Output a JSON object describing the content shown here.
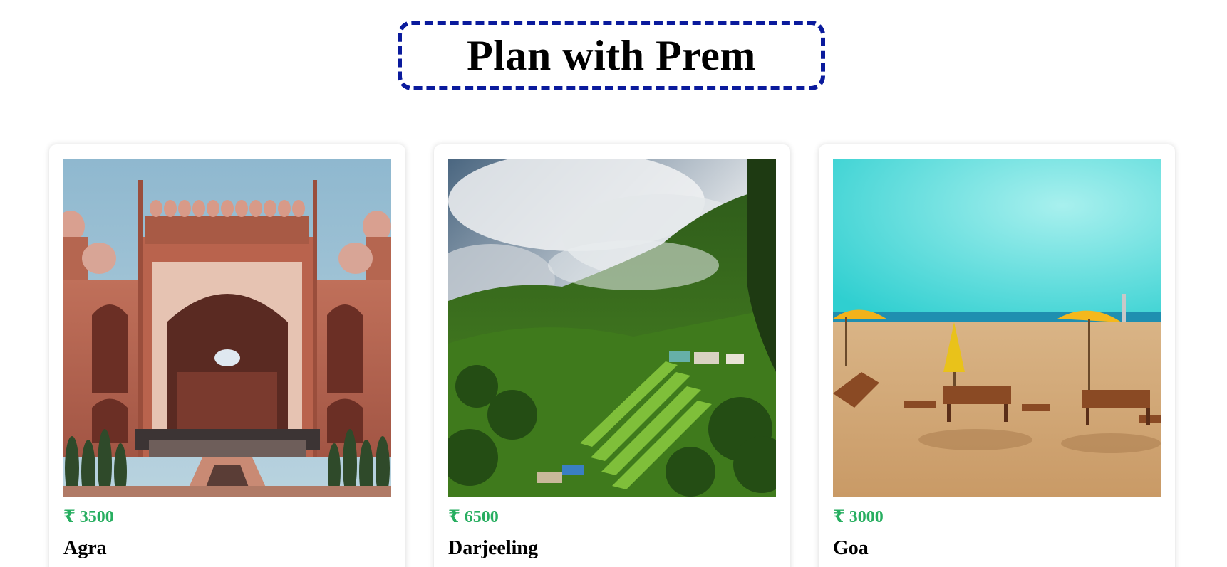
{
  "header": {
    "title": "Plan with Prem"
  },
  "destinations": [
    {
      "price": "₹ 3500",
      "name": "Agra",
      "image": "taj-mahal-gate-photo"
    },
    {
      "price": "₹ 6500",
      "name": "Darjeeling",
      "image": "misty-hills-photo"
    },
    {
      "price": "₹ 3000",
      "name": "Goa",
      "image": "beach-umbrellas-photo"
    }
  ],
  "colors": {
    "title_border": "#0a1a9c",
    "price": "#27ae60",
    "text": "#000000"
  }
}
